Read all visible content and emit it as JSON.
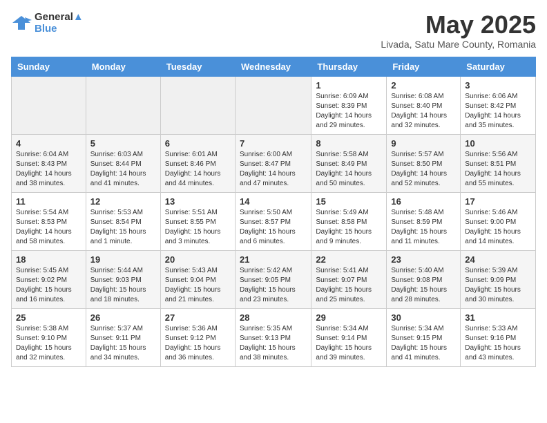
{
  "header": {
    "logo_line1": "General",
    "logo_line2": "Blue",
    "month_year": "May 2025",
    "location": "Livada, Satu Mare County, Romania"
  },
  "weekdays": [
    "Sunday",
    "Monday",
    "Tuesday",
    "Wednesday",
    "Thursday",
    "Friday",
    "Saturday"
  ],
  "weeks": [
    [
      {
        "day": "",
        "info": ""
      },
      {
        "day": "",
        "info": ""
      },
      {
        "day": "",
        "info": ""
      },
      {
        "day": "",
        "info": ""
      },
      {
        "day": "1",
        "info": "Sunrise: 6:09 AM\nSunset: 8:39 PM\nDaylight: 14 hours and 29 minutes."
      },
      {
        "day": "2",
        "info": "Sunrise: 6:08 AM\nSunset: 8:40 PM\nDaylight: 14 hours and 32 minutes."
      },
      {
        "day": "3",
        "info": "Sunrise: 6:06 AM\nSunset: 8:42 PM\nDaylight: 14 hours and 35 minutes."
      }
    ],
    [
      {
        "day": "4",
        "info": "Sunrise: 6:04 AM\nSunset: 8:43 PM\nDaylight: 14 hours and 38 minutes."
      },
      {
        "day": "5",
        "info": "Sunrise: 6:03 AM\nSunset: 8:44 PM\nDaylight: 14 hours and 41 minutes."
      },
      {
        "day": "6",
        "info": "Sunrise: 6:01 AM\nSunset: 8:46 PM\nDaylight: 14 hours and 44 minutes."
      },
      {
        "day": "7",
        "info": "Sunrise: 6:00 AM\nSunset: 8:47 PM\nDaylight: 14 hours and 47 minutes."
      },
      {
        "day": "8",
        "info": "Sunrise: 5:58 AM\nSunset: 8:49 PM\nDaylight: 14 hours and 50 minutes."
      },
      {
        "day": "9",
        "info": "Sunrise: 5:57 AM\nSunset: 8:50 PM\nDaylight: 14 hours and 52 minutes."
      },
      {
        "day": "10",
        "info": "Sunrise: 5:56 AM\nSunset: 8:51 PM\nDaylight: 14 hours and 55 minutes."
      }
    ],
    [
      {
        "day": "11",
        "info": "Sunrise: 5:54 AM\nSunset: 8:53 PM\nDaylight: 14 hours and 58 minutes."
      },
      {
        "day": "12",
        "info": "Sunrise: 5:53 AM\nSunset: 8:54 PM\nDaylight: 15 hours and 1 minute."
      },
      {
        "day": "13",
        "info": "Sunrise: 5:51 AM\nSunset: 8:55 PM\nDaylight: 15 hours and 3 minutes."
      },
      {
        "day": "14",
        "info": "Sunrise: 5:50 AM\nSunset: 8:57 PM\nDaylight: 15 hours and 6 minutes."
      },
      {
        "day": "15",
        "info": "Sunrise: 5:49 AM\nSunset: 8:58 PM\nDaylight: 15 hours and 9 minutes."
      },
      {
        "day": "16",
        "info": "Sunrise: 5:48 AM\nSunset: 8:59 PM\nDaylight: 15 hours and 11 minutes."
      },
      {
        "day": "17",
        "info": "Sunrise: 5:46 AM\nSunset: 9:00 PM\nDaylight: 15 hours and 14 minutes."
      }
    ],
    [
      {
        "day": "18",
        "info": "Sunrise: 5:45 AM\nSunset: 9:02 PM\nDaylight: 15 hours and 16 minutes."
      },
      {
        "day": "19",
        "info": "Sunrise: 5:44 AM\nSunset: 9:03 PM\nDaylight: 15 hours and 18 minutes."
      },
      {
        "day": "20",
        "info": "Sunrise: 5:43 AM\nSunset: 9:04 PM\nDaylight: 15 hours and 21 minutes."
      },
      {
        "day": "21",
        "info": "Sunrise: 5:42 AM\nSunset: 9:05 PM\nDaylight: 15 hours and 23 minutes."
      },
      {
        "day": "22",
        "info": "Sunrise: 5:41 AM\nSunset: 9:07 PM\nDaylight: 15 hours and 25 minutes."
      },
      {
        "day": "23",
        "info": "Sunrise: 5:40 AM\nSunset: 9:08 PM\nDaylight: 15 hours and 28 minutes."
      },
      {
        "day": "24",
        "info": "Sunrise: 5:39 AM\nSunset: 9:09 PM\nDaylight: 15 hours and 30 minutes."
      }
    ],
    [
      {
        "day": "25",
        "info": "Sunrise: 5:38 AM\nSunset: 9:10 PM\nDaylight: 15 hours and 32 minutes."
      },
      {
        "day": "26",
        "info": "Sunrise: 5:37 AM\nSunset: 9:11 PM\nDaylight: 15 hours and 34 minutes."
      },
      {
        "day": "27",
        "info": "Sunrise: 5:36 AM\nSunset: 9:12 PM\nDaylight: 15 hours and 36 minutes."
      },
      {
        "day": "28",
        "info": "Sunrise: 5:35 AM\nSunset: 9:13 PM\nDaylight: 15 hours and 38 minutes."
      },
      {
        "day": "29",
        "info": "Sunrise: 5:34 AM\nSunset: 9:14 PM\nDaylight: 15 hours and 39 minutes."
      },
      {
        "day": "30",
        "info": "Sunrise: 5:34 AM\nSunset: 9:15 PM\nDaylight: 15 hours and 41 minutes."
      },
      {
        "day": "31",
        "info": "Sunrise: 5:33 AM\nSunset: 9:16 PM\nDaylight: 15 hours and 43 minutes."
      }
    ]
  ]
}
